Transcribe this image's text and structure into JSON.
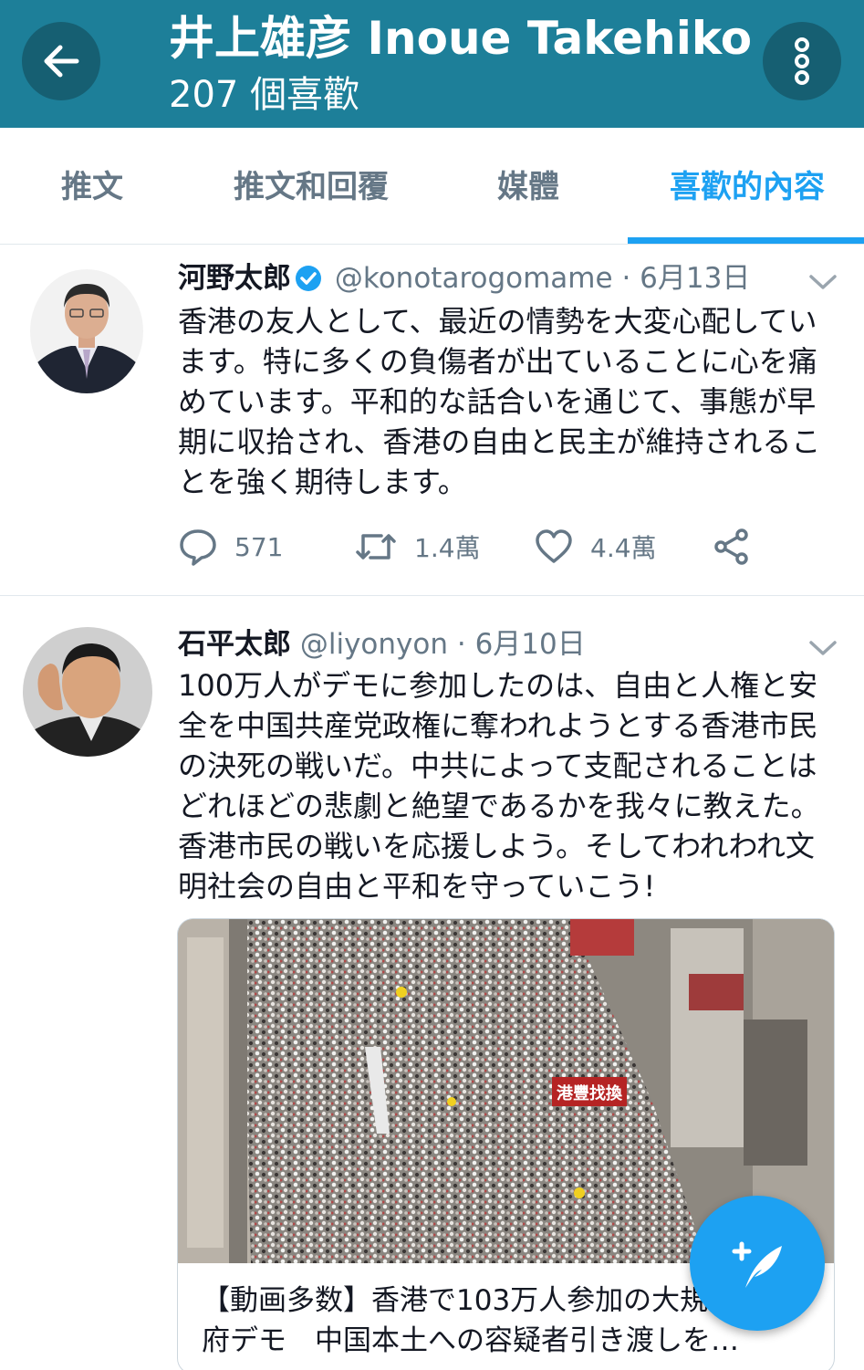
{
  "header": {
    "title": "井上雄彦 Inoue Takehiko",
    "subtitle": "207 個喜歡",
    "back_icon": "arrow-left-icon",
    "more_icon": "more-vertical-icon"
  },
  "tabs": [
    {
      "label": "推文",
      "active": false
    },
    {
      "label": "推文和回覆",
      "active": false
    },
    {
      "label": "媒體",
      "active": false
    },
    {
      "label": "喜歡的內容",
      "active": true
    }
  ],
  "tweets": [
    {
      "name": "河野太郎",
      "verified": true,
      "handle": "@konotarogomame",
      "date": "· 6月13日",
      "text": "香港の友人として、最近の情勢を大変心配しています。特に多くの負傷者が出ていることに心を痛めています。平和的な話合いを通じて、事態が早期に収拾され、香港の自由と民主が維持されることを強く期待します。",
      "replies": "571",
      "retweets": "1.4萬",
      "likes": "4.4萬"
    },
    {
      "name": "石平太郎",
      "verified": false,
      "handle": "@liyonyon",
      "date": "· 6月10日",
      "text": "100万人がデモに参加したのは、自由と人権と安全を中国共産党政権に奪われようとする香港市民の決死の戦いだ。中共によって支配されることはどれほどの悲劇と絶望であるかを我々に教えた。香港市民の戦いを応援しよう。そしてわれわれ文明社会の自由と平和を守っていこう!",
      "card": {
        "title": "【動画多数】香港で103万人参加の大規模反政府デモ　中国本土への容疑者引き渡しを…",
        "sign_text": "港豐找換"
      }
    }
  ],
  "colors": {
    "header_bg": "#1d7f99",
    "accent": "#1da1f2",
    "muted": "#657786"
  }
}
